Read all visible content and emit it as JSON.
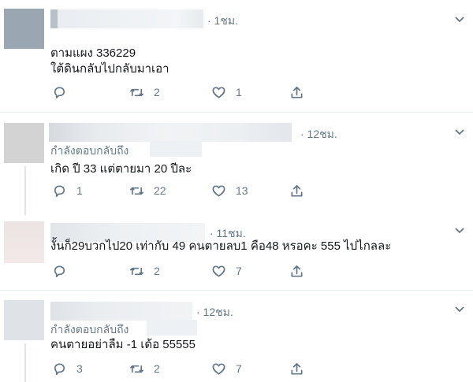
{
  "tweets": [
    {
      "time": "· 1ชม.",
      "reply_to": "",
      "lines": [
        "ตามแผง 336229",
        "ใต้ดินกลับไปกลับมาเอา"
      ],
      "replies": "",
      "retweets": "2",
      "likes": "1"
    },
    {
      "time": "· 12ชม.",
      "reply_to": "กำลังตอบกลับถึง",
      "lines": [
        "เกิด ปี 33 แต่ตายมา 20 ปีละ"
      ],
      "replies": "1",
      "retweets": "22",
      "likes": "13"
    },
    {
      "time": "· 11ชม.",
      "reply_to": "",
      "lines": [
        "งั้นก็29บวกไป20 เท่ากับ 49 คนตายลบ1 คือ48 หรอคะ 555 ไปไกลละ"
      ],
      "replies": "",
      "retweets": "2",
      "likes": "7"
    },
    {
      "time": "· 12ชม.",
      "reply_to": "กำลังตอบกลับถึง",
      "lines": [
        "คนตายอย่าลืม -1 เด้อ 55555"
      ],
      "replies": "3",
      "retweets": "2",
      "likes": "7"
    }
  ]
}
